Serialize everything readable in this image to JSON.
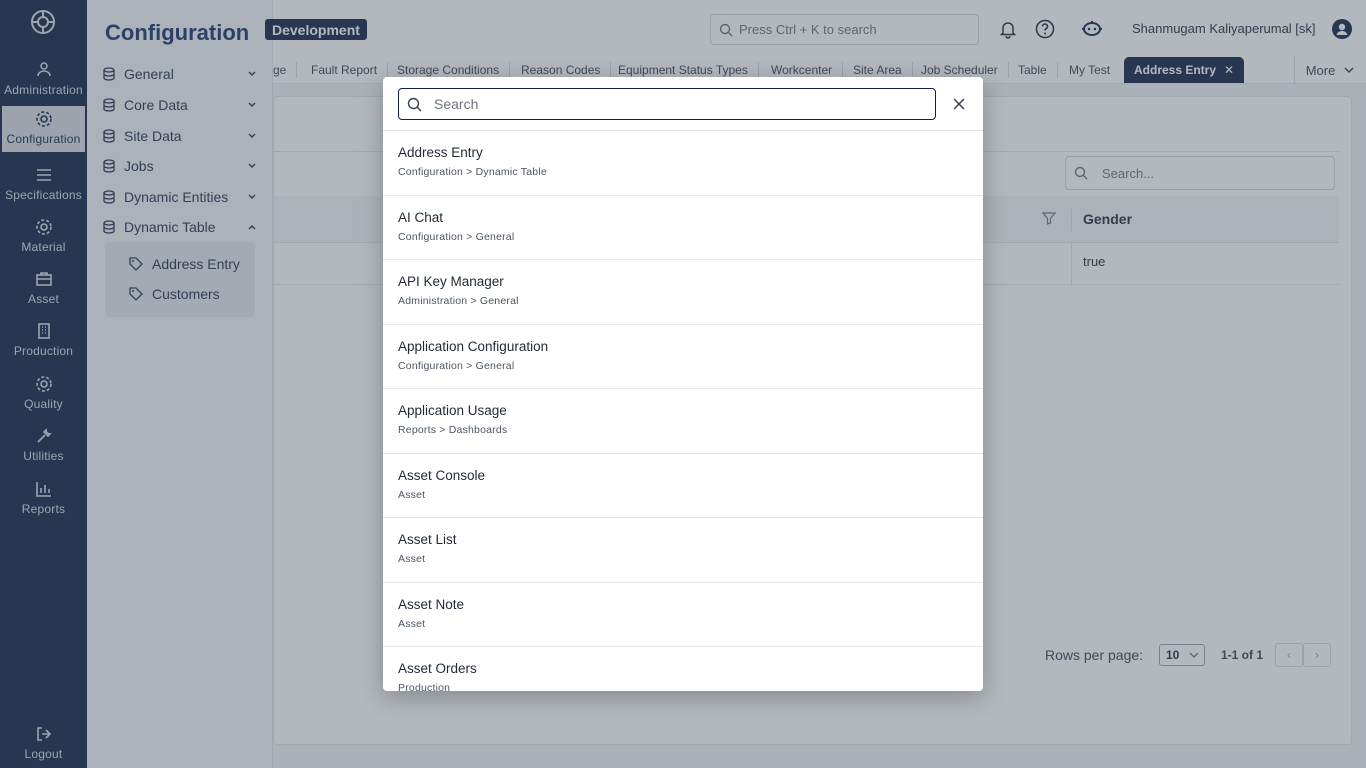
{
  "rail": {
    "items": [
      {
        "label": "Administration",
        "icon": "user-group-icon"
      },
      {
        "label": "Configuration",
        "icon": "gear-icon",
        "active": true
      },
      {
        "label": "Specifications",
        "icon": "list-icon"
      },
      {
        "label": "Material",
        "icon": "gear-icon"
      },
      {
        "label": "Asset",
        "icon": "briefcase-icon"
      },
      {
        "label": "Production",
        "icon": "building-icon"
      },
      {
        "label": "Quality",
        "icon": "gear-icon"
      },
      {
        "label": "Utilities",
        "icon": "wrench-icon"
      },
      {
        "label": "Reports",
        "icon": "bar-chart-icon"
      }
    ],
    "logout": "Logout"
  },
  "sidebar": {
    "title": "Configuration",
    "items": [
      {
        "label": "General"
      },
      {
        "label": "Core Data"
      },
      {
        "label": "Site Data"
      },
      {
        "label": "Jobs"
      },
      {
        "label": "Dynamic Entities"
      },
      {
        "label": "Dynamic Table",
        "expanded": true
      }
    ],
    "sub_items": [
      {
        "label": "Address Entry"
      },
      {
        "label": "Customers"
      }
    ]
  },
  "header": {
    "env_badge": "Development",
    "search_placeholder": "Press Ctrl + K to search",
    "user_name": "Shanmugam Kaliyaperumal [sk]"
  },
  "tabs": {
    "items": [
      "ge",
      "Fault Report",
      "Storage Conditions",
      "Reason Codes",
      "Equipment Status Types",
      "Workcenter",
      "Site Area",
      "Job Scheduler",
      "Table",
      "My Test"
    ],
    "active": "Address Entry",
    "more": "More"
  },
  "content": {
    "search_placeholder": "Search...",
    "column_gender": "Gender",
    "row_gender": "true",
    "rows_per_page_label": "Rows per page:",
    "rows_per_page_value": "10",
    "range": "1-1 of 1"
  },
  "modal": {
    "search_placeholder": "Search",
    "results": [
      {
        "title": "Address Entry",
        "path": "Configuration > Dynamic Table"
      },
      {
        "title": "AI Chat",
        "path": "Configuration > General"
      },
      {
        "title": "API Key Manager",
        "path": "Administration > General"
      },
      {
        "title": "Application Configuration",
        "path": "Configuration > General"
      },
      {
        "title": "Application Usage",
        "path": "Reports > Dashboards"
      },
      {
        "title": "Asset Console",
        "path": "Asset"
      },
      {
        "title": "Asset List",
        "path": "Asset"
      },
      {
        "title": "Asset Note",
        "path": "Asset"
      },
      {
        "title": "Asset Orders",
        "path": "Production"
      }
    ]
  },
  "colors": {
    "navy": "#0e2146",
    "overlay": "rgba(75,85,99,0.42)"
  }
}
